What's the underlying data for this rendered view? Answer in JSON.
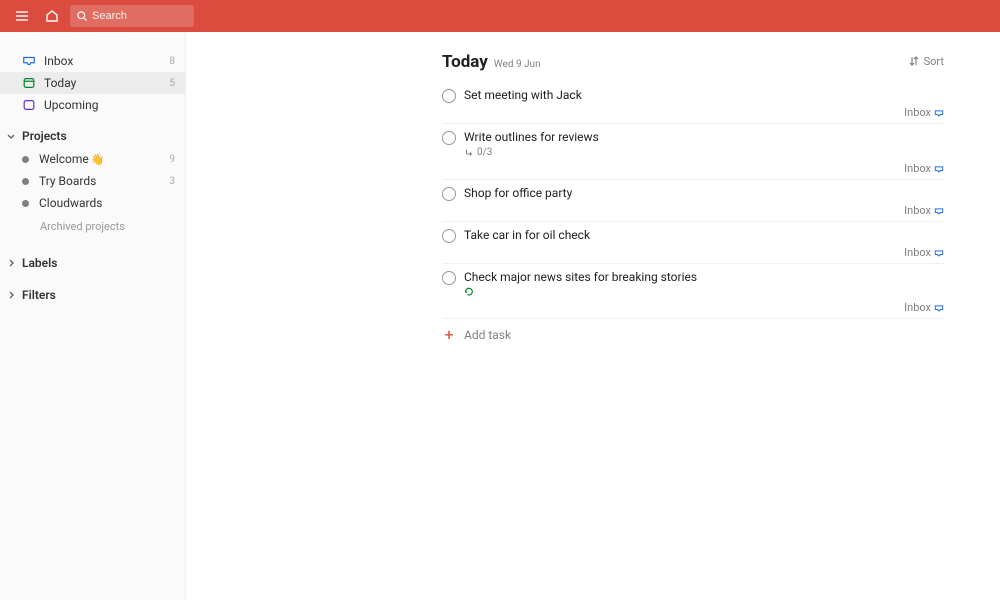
{
  "colors": {
    "accent": "#db4c3f"
  },
  "topbar": {
    "search_placeholder": "Search"
  },
  "sidebar": {
    "nav": [
      {
        "key": "inbox",
        "label": "Inbox",
        "count": "8"
      },
      {
        "key": "today",
        "label": "Today",
        "count": "5"
      },
      {
        "key": "upcoming",
        "label": "Upcoming",
        "count": ""
      }
    ],
    "projects_label": "Projects",
    "projects": [
      {
        "label": "Welcome",
        "emoji": "👋",
        "count": "9"
      },
      {
        "label": "Try Boards",
        "emoji": "",
        "count": "3"
      },
      {
        "label": "Cloudwards",
        "emoji": "",
        "count": ""
      }
    ],
    "archived_label": "Archived projects",
    "labels_label": "Labels",
    "filters_label": "Filters"
  },
  "main": {
    "title": "Today",
    "date": "Wed 9 Jun",
    "sort_label": "Sort",
    "project_name": "Inbox",
    "add_task_label": "Add task",
    "tasks": [
      {
        "title": "Set meeting with Jack",
        "sub": "",
        "recurring": false
      },
      {
        "title": "Write outlines for reviews",
        "sub": "0/3",
        "recurring": false
      },
      {
        "title": "Shop for office party",
        "sub": "",
        "recurring": false
      },
      {
        "title": "Take car in for oil check",
        "sub": "",
        "recurring": false
      },
      {
        "title": "Check major news sites for breaking stories",
        "sub": "",
        "recurring": true
      }
    ]
  }
}
